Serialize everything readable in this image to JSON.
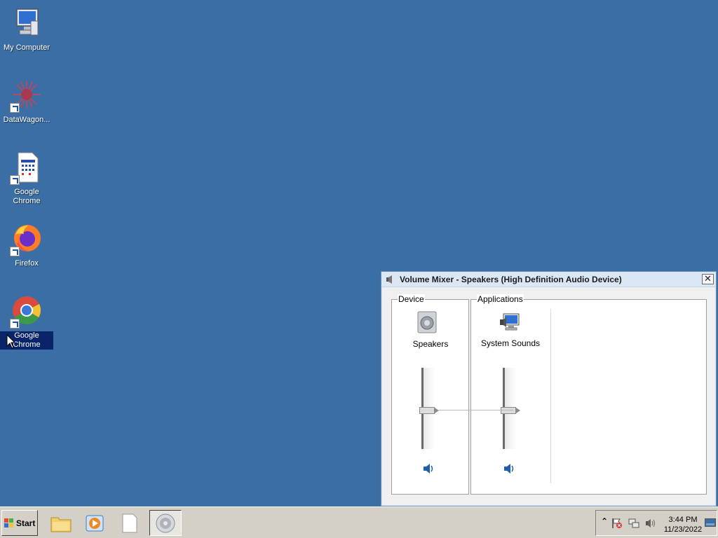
{
  "desktop": {
    "icons": [
      {
        "label": "My Computer"
      },
      {
        "label": "DataWagon..."
      },
      {
        "label": "Google Chrome"
      },
      {
        "label": "Firefox"
      },
      {
        "label": "Google Chrome"
      }
    ],
    "background_color": "#3a6ea5"
  },
  "mixer": {
    "title": "Volume Mixer - Speakers (High Definition Audio Device)",
    "device_group": "Device",
    "applications_group": "Applications",
    "device_channel": {
      "name": "Speakers",
      "level": 0.5
    },
    "app_channel": {
      "name": "System Sounds",
      "level": 0.5
    },
    "close_glyph": "✕"
  },
  "taskbar": {
    "start_label": "Start",
    "tray_expand_glyph": "⌃",
    "clock_time": "3:44 PM",
    "clock_date": "11/23/2022"
  }
}
